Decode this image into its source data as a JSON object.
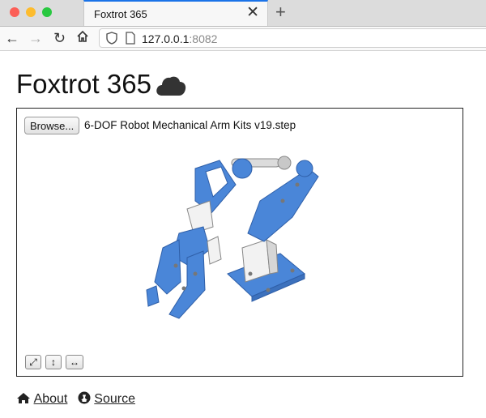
{
  "browser": {
    "tab_title": "Foxtrot 365",
    "url_host": "127.0.0.1",
    "url_port": ":8082"
  },
  "page": {
    "title": "Foxtrot 365",
    "title_icon": "cloud-icon"
  },
  "viewer": {
    "browse_label": "Browse...",
    "file_name": "6-DOF Robot Mechanical Arm Kits v19.step",
    "controls": [
      "expand-diagonal-icon",
      "arrows-vertical-icon",
      "arrows-horizontal-icon"
    ],
    "model_color": "#4a86d8"
  },
  "footer": {
    "about_label": "About",
    "source_label": "Source"
  }
}
